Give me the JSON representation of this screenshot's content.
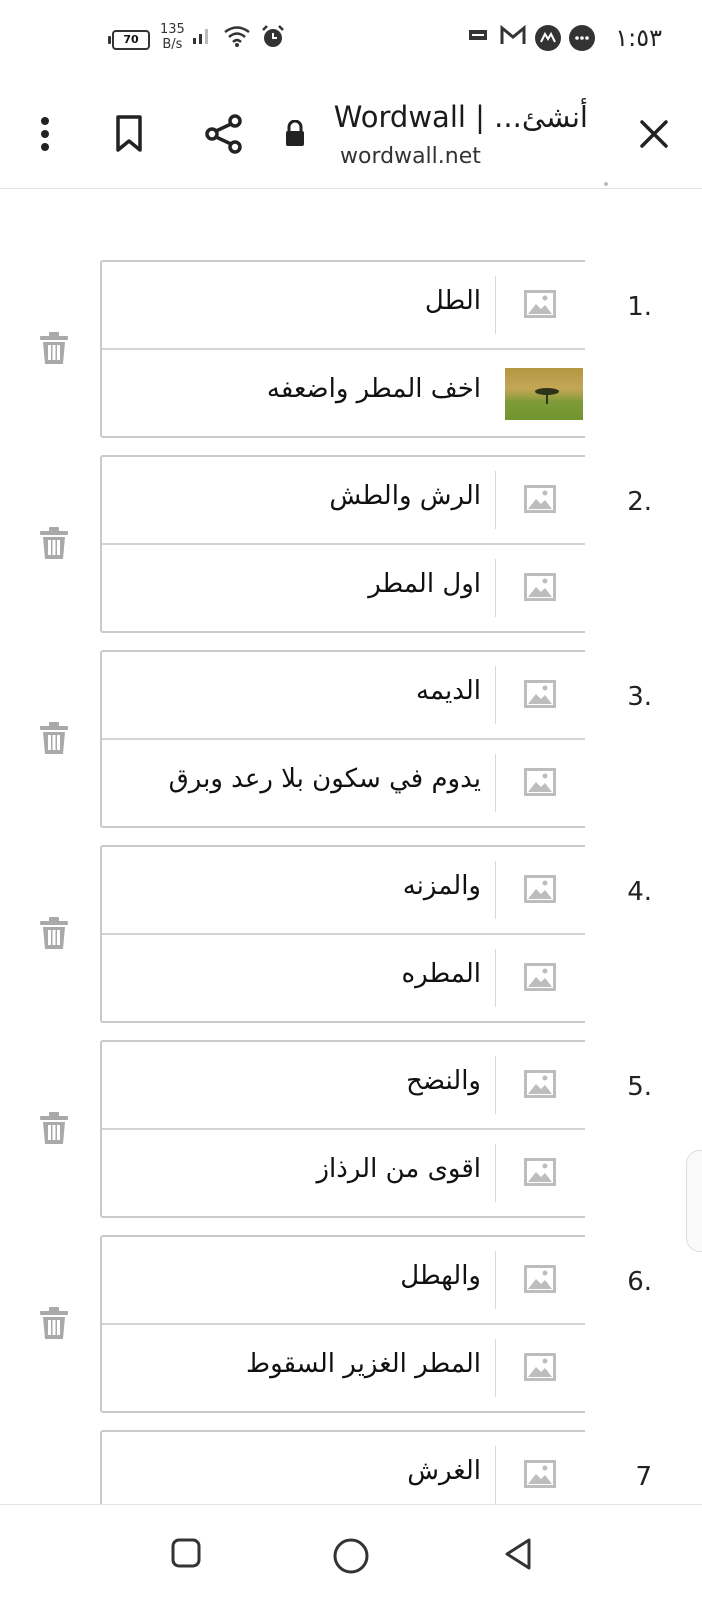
{
  "status_bar": {
    "time": "١:٥٣",
    "battery": "70",
    "speed_value": "135",
    "speed_unit": "B/s"
  },
  "browser": {
    "title": "أنشئ... | Wordwall",
    "url": "wordwall.net"
  },
  "items": [
    {
      "number": "1.",
      "keyword": "الطل",
      "definition": "اخف المطر واضعفه"
    },
    {
      "number": "2.",
      "keyword": "الرش والطش",
      "definition": "اول المطر"
    },
    {
      "number": "3.",
      "keyword": "الديمه",
      "definition": "يدوم في سكون بلا رعد وبرق"
    },
    {
      "number": "4.",
      "keyword": "والمزنه",
      "definition": "المطره"
    },
    {
      "number": "5.",
      "keyword": "والنضح",
      "definition": "اقوى من الرذاز"
    },
    {
      "number": "6.",
      "keyword": "والهطل",
      "definition": "المطر الغزير السقوط"
    },
    {
      "number": "7",
      "keyword": "الغرش",
      "definition": ""
    }
  ]
}
